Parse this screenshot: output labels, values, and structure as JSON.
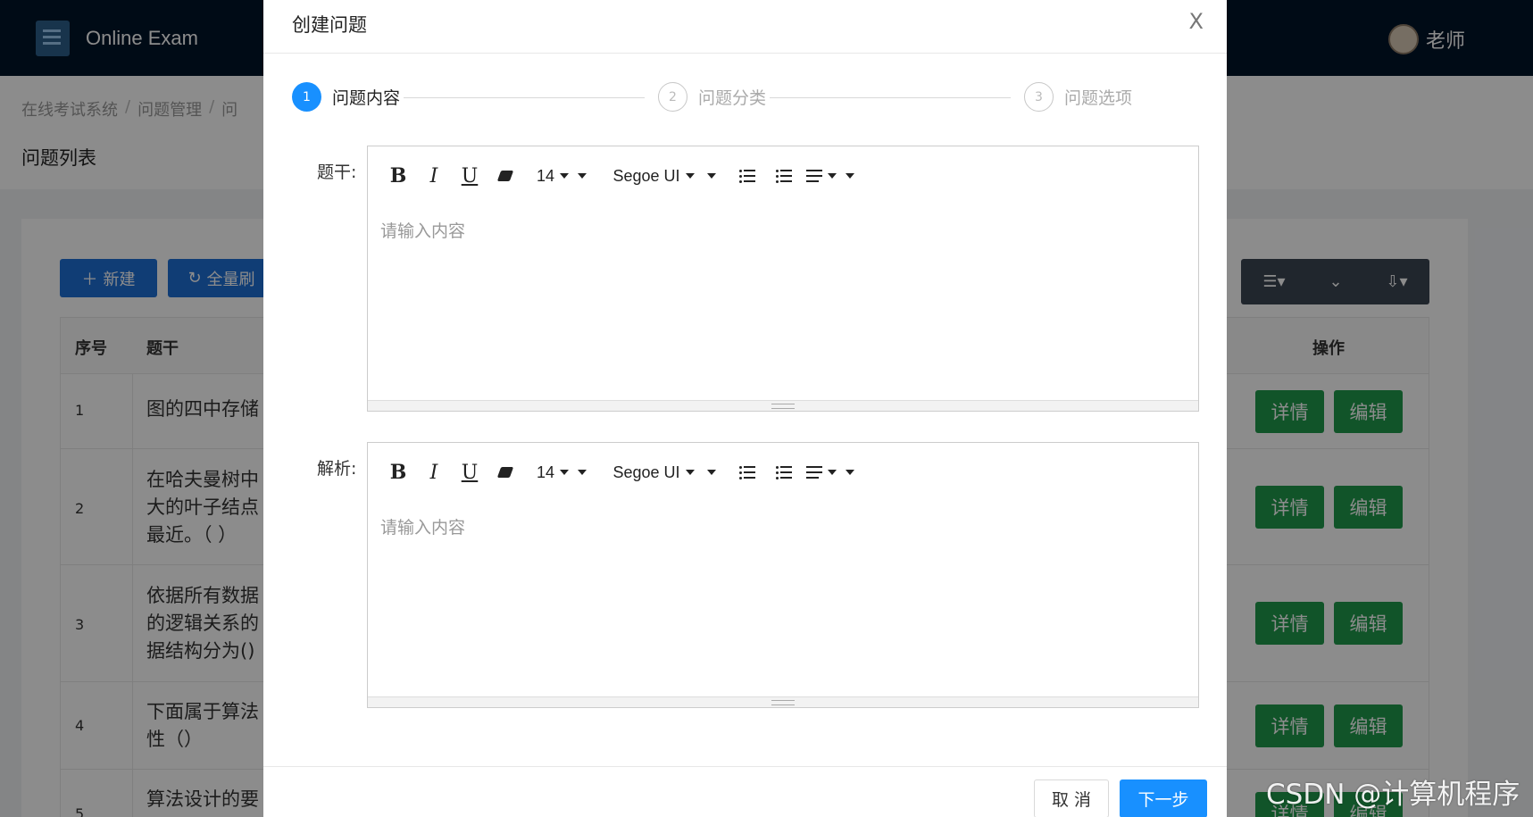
{
  "app": {
    "name": "Online Exam",
    "user_name": "老师"
  },
  "breadcrumb": {
    "items": [
      "在线考试系统",
      "问题管理",
      "问"
    ],
    "separator": "/"
  },
  "page": {
    "title": "问题列表"
  },
  "toolbar": {
    "new_label": "新建",
    "refresh_label": "全量刷"
  },
  "table": {
    "headers": {
      "no": "序号",
      "stem": "题干",
      "op": "操作"
    },
    "rows": [
      {
        "no": "1",
        "stem": "图的四中存储"
      },
      {
        "no": "2",
        "stem": "在哈夫曼树中大的叶子结点最近。（ ）"
      },
      {
        "no": "3",
        "stem": "依据所有数据的逻辑关系的据结构分为()"
      },
      {
        "no": "4",
        "stem": "下面属于算法性（）"
      },
      {
        "no": "5",
        "stem": "算法设计的要"
      }
    ],
    "detail_label": "详情",
    "edit_label": "编辑"
  },
  "modal": {
    "title": "创建问题",
    "close_symbol": "X",
    "steps": [
      {
        "number": "1",
        "label": "问题内容",
        "state": "active"
      },
      {
        "number": "2",
        "label": "问题分类",
        "state": "wait"
      },
      {
        "number": "3",
        "label": "问题选项",
        "state": "wait"
      }
    ],
    "stem_label": "题干:",
    "analysis_label": "解析:",
    "editor": {
      "bold": "B",
      "italic": "I",
      "underline": "U",
      "font_size": "14",
      "font_family": "Segoe UI",
      "placeholder": "请输入内容"
    },
    "cancel_label": "取 消",
    "next_label": "下一步"
  },
  "watermark": "CSDN @计算机程序",
  "colors": {
    "primary": "#1890ff",
    "topbar": "#001529",
    "success": "#1f9a4c"
  }
}
